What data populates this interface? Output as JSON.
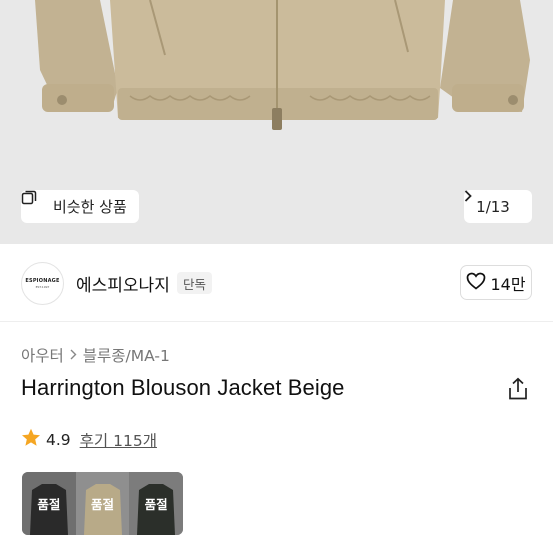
{
  "hero": {
    "similar_label": "비슷한 상품",
    "image_counter": "1/13",
    "colors": {
      "background": "#e8e8e8",
      "jacket": "#c9b99a",
      "jacket_shade": "#b7a683"
    }
  },
  "brand": {
    "logo_text": "ESPIONAGE",
    "logo_subtext": "EST.1997",
    "name": "에스피오나지",
    "tag": "단독",
    "likes": "14만"
  },
  "product": {
    "breadcrumb": [
      "아우터",
      "블루종/MA-1"
    ],
    "title": "Harrington Blouson Jacket Beige",
    "rating": "4.9",
    "reviews": "후기 115개",
    "star_color": "#f5a623"
  },
  "swatches": [
    {
      "label": "품절",
      "color": "#2a2a2a"
    },
    {
      "label": "품절",
      "color": "#b8aa88"
    },
    {
      "label": "품절",
      "color": "#2b2f2a"
    }
  ]
}
